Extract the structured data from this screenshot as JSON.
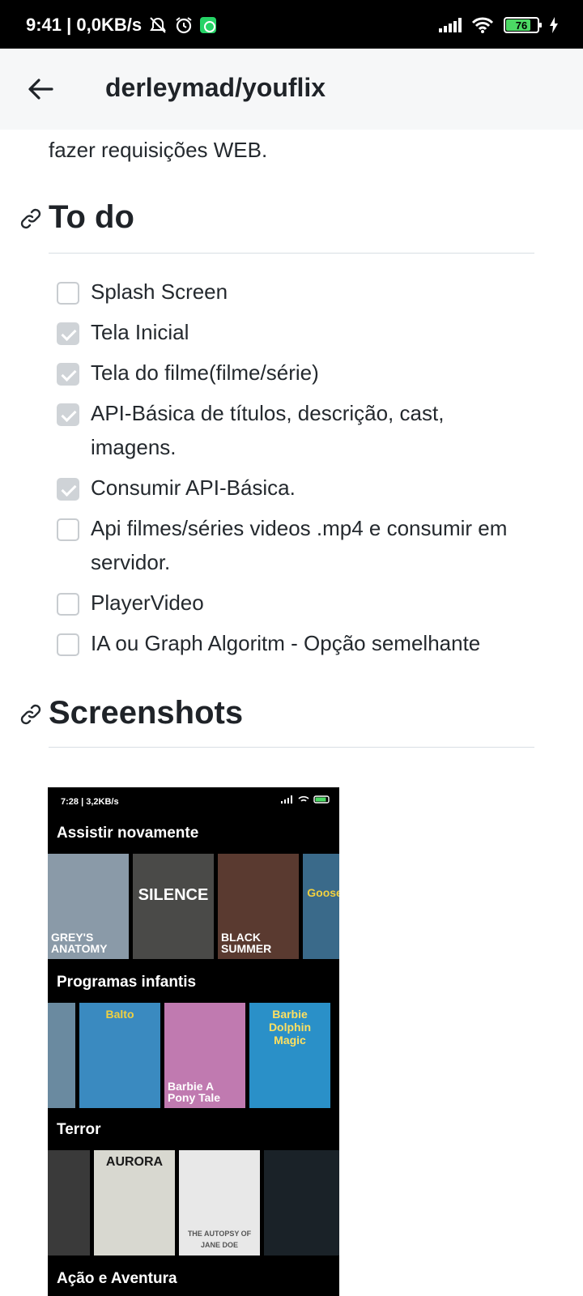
{
  "status_bar": {
    "time_info": "9:41 | 0,0KB/s",
    "battery": "76"
  },
  "app_bar": {
    "title": "derleymad/youflix"
  },
  "intro_text": "fazer requisições WEB.",
  "todo": {
    "heading": "To do",
    "items": [
      {
        "label": "Splash Screen",
        "checked": false
      },
      {
        "label": "Tela Inicial",
        "checked": true
      },
      {
        "label": "Tela do filme(filme/série)",
        "checked": true
      },
      {
        "label": "API-Básica de títulos, descrição, cast, imagens.",
        "checked": true
      },
      {
        "label": "Consumir API-Básica.",
        "checked": true
      },
      {
        "label": "Api filmes/séries videos .mp4 e consumir em servidor.",
        "checked": false
      },
      {
        "label": "PlayerVideo",
        "checked": false
      },
      {
        "label": "IA ou Graph Algoritm - Opção semelhante",
        "checked": false
      }
    ]
  },
  "screenshots": {
    "heading": "Screenshots",
    "image": {
      "status": "7:28 | 3,2KB/s",
      "sections": [
        {
          "title": "Assistir novamente",
          "posters": [
            {
              "text": "GREY'S ANATOMY",
              "color": "#8a9aa8"
            },
            {
              "text": "SILENCE",
              "color": "#4a4a48"
            },
            {
              "text": "BLACK SUMMER",
              "color": "#5a3a30"
            },
            {
              "text": "Goosebumps",
              "color": "#3a6a8a"
            }
          ]
        },
        {
          "title": "Programas infantis",
          "posters": [
            {
              "text": "",
              "color": "#6a8aa0"
            },
            {
              "text": "Balto",
              "color": "#3a8ac0"
            },
            {
              "text": "Barbie A Pony Tale",
              "color": "#c07ab0"
            },
            {
              "text": "Barbie Dolphin Magic",
              "color": "#2a90c8"
            }
          ]
        },
        {
          "title": "Terror",
          "posters": [
            {
              "text": "",
              "color": "#3a3a3a"
            },
            {
              "text": "AURORA",
              "color": "#d8d8d0"
            },
            {
              "text": "THE AUTOPSY OF JANE DOE",
              "color": "#e8e8e8"
            },
            {
              "text": "",
              "color": "#1a2228"
            }
          ]
        },
        {
          "title": "Ação e Aventura",
          "posters": []
        }
      ]
    }
  }
}
